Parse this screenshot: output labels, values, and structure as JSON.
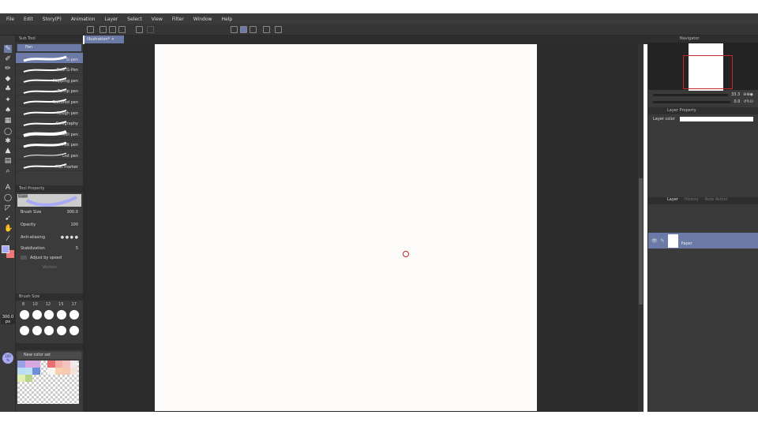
{
  "menu": [
    "File",
    "Edit",
    "Story(P)",
    "Animation",
    "Layer",
    "Select",
    "View",
    "Filter",
    "Window",
    "Help"
  ],
  "document_tab": "Illustration*",
  "subtool": {
    "header": "Sub Tool",
    "group": "Pen",
    "brushes": [
      "G-pen",
      "Real G-Pen",
      "Mapping pen",
      "Turnip pen",
      "Textured pen",
      "Rough pen",
      "Calligraphy",
      "Milli pen",
      "Felt pen",
      "Dot pen",
      "Flat marker"
    ]
  },
  "tool_property": {
    "header": "Tool Property",
    "preview_label": "G-pen",
    "brush_size_label": "Brush Size",
    "brush_size": "300.0",
    "opacity_label": "Opacity",
    "opacity": "100",
    "antialiasing_label": "Anti-aliasing",
    "stabilization_label": "Stabilization",
    "stabilization": "5",
    "adjust_speed_label": "Adjust by speed",
    "vectors_label": "Vectors"
  },
  "brush_size_panel": {
    "header": "Brush Size",
    "sizes": [
      "8",
      "10",
      "12",
      "15",
      "17"
    ]
  },
  "tool_size_readout": "300.0",
  "tool_size_unit": "px",
  "opacity_readout": "100",
  "opacity_unit": "%",
  "color_set": {
    "name": "New color set",
    "colors": [
      "#9aa0e6",
      "#d9a6e0",
      "#d6a8e2",
      "",
      "#e87070",
      "#f3b0a8",
      "#f5c3bd",
      "#f0e8ea",
      "#b9dcf3",
      "#bfe0f5",
      "#6e8fd8",
      "",
      "#fbf6f0",
      "#f8d0b0",
      "#f6c8b0",
      "#f4e2d6",
      "#e1f0b0",
      "#b5d48a"
    ]
  },
  "colors": {
    "main": "#a9aaf5",
    "sub": "#f07878",
    "accent": "#6b7aa6",
    "nav_frame": "#c0262c"
  },
  "navigator": {
    "header": "Navigator",
    "zoom": "33.3",
    "rotation": "0.0"
  },
  "layer_property": {
    "header": "Layer Property",
    "layer_color_label": "Layer color"
  },
  "layer_panel": {
    "tabs": [
      "Layer",
      "History",
      "Auto Action"
    ],
    "layers": [
      {
        "name": "Paper"
      }
    ]
  }
}
